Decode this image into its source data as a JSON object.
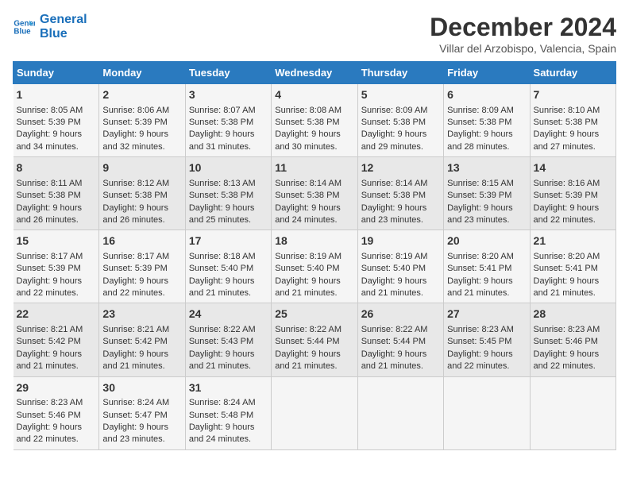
{
  "logo": {
    "line1": "General",
    "line2": "Blue"
  },
  "title": "December 2024",
  "subtitle": "Villar del Arzobispo, Valencia, Spain",
  "days_of_week": [
    "Sunday",
    "Monday",
    "Tuesday",
    "Wednesday",
    "Thursday",
    "Friday",
    "Saturday"
  ],
  "weeks": [
    [
      {
        "day": 1,
        "sunrise": "8:05 AM",
        "sunset": "5:39 PM",
        "daylight": "9 hours and 34 minutes."
      },
      {
        "day": 2,
        "sunrise": "8:06 AM",
        "sunset": "5:39 PM",
        "daylight": "9 hours and 32 minutes."
      },
      {
        "day": 3,
        "sunrise": "8:07 AM",
        "sunset": "5:38 PM",
        "daylight": "9 hours and 31 minutes."
      },
      {
        "day": 4,
        "sunrise": "8:08 AM",
        "sunset": "5:38 PM",
        "daylight": "9 hours and 30 minutes."
      },
      {
        "day": 5,
        "sunrise": "8:09 AM",
        "sunset": "5:38 PM",
        "daylight": "9 hours and 29 minutes."
      },
      {
        "day": 6,
        "sunrise": "8:09 AM",
        "sunset": "5:38 PM",
        "daylight": "9 hours and 28 minutes."
      },
      {
        "day": 7,
        "sunrise": "8:10 AM",
        "sunset": "5:38 PM",
        "daylight": "9 hours and 27 minutes."
      }
    ],
    [
      {
        "day": 8,
        "sunrise": "8:11 AM",
        "sunset": "5:38 PM",
        "daylight": "9 hours and 26 minutes."
      },
      {
        "day": 9,
        "sunrise": "8:12 AM",
        "sunset": "5:38 PM",
        "daylight": "9 hours and 26 minutes."
      },
      {
        "day": 10,
        "sunrise": "8:13 AM",
        "sunset": "5:38 PM",
        "daylight": "9 hours and 25 minutes."
      },
      {
        "day": 11,
        "sunrise": "8:14 AM",
        "sunset": "5:38 PM",
        "daylight": "9 hours and 24 minutes."
      },
      {
        "day": 12,
        "sunrise": "8:14 AM",
        "sunset": "5:38 PM",
        "daylight": "9 hours and 23 minutes."
      },
      {
        "day": 13,
        "sunrise": "8:15 AM",
        "sunset": "5:39 PM",
        "daylight": "9 hours and 23 minutes."
      },
      {
        "day": 14,
        "sunrise": "8:16 AM",
        "sunset": "5:39 PM",
        "daylight": "9 hours and 22 minutes."
      }
    ],
    [
      {
        "day": 15,
        "sunrise": "8:17 AM",
        "sunset": "5:39 PM",
        "daylight": "9 hours and 22 minutes."
      },
      {
        "day": 16,
        "sunrise": "8:17 AM",
        "sunset": "5:39 PM",
        "daylight": "9 hours and 22 minutes."
      },
      {
        "day": 17,
        "sunrise": "8:18 AM",
        "sunset": "5:40 PM",
        "daylight": "9 hours and 21 minutes."
      },
      {
        "day": 18,
        "sunrise": "8:19 AM",
        "sunset": "5:40 PM",
        "daylight": "9 hours and 21 minutes."
      },
      {
        "day": 19,
        "sunrise": "8:19 AM",
        "sunset": "5:40 PM",
        "daylight": "9 hours and 21 minutes."
      },
      {
        "day": 20,
        "sunrise": "8:20 AM",
        "sunset": "5:41 PM",
        "daylight": "9 hours and 21 minutes."
      },
      {
        "day": 21,
        "sunrise": "8:20 AM",
        "sunset": "5:41 PM",
        "daylight": "9 hours and 21 minutes."
      }
    ],
    [
      {
        "day": 22,
        "sunrise": "8:21 AM",
        "sunset": "5:42 PM",
        "daylight": "9 hours and 21 minutes."
      },
      {
        "day": 23,
        "sunrise": "8:21 AM",
        "sunset": "5:42 PM",
        "daylight": "9 hours and 21 minutes."
      },
      {
        "day": 24,
        "sunrise": "8:22 AM",
        "sunset": "5:43 PM",
        "daylight": "9 hours and 21 minutes."
      },
      {
        "day": 25,
        "sunrise": "8:22 AM",
        "sunset": "5:44 PM",
        "daylight": "9 hours and 21 minutes."
      },
      {
        "day": 26,
        "sunrise": "8:22 AM",
        "sunset": "5:44 PM",
        "daylight": "9 hours and 21 minutes."
      },
      {
        "day": 27,
        "sunrise": "8:23 AM",
        "sunset": "5:45 PM",
        "daylight": "9 hours and 22 minutes."
      },
      {
        "day": 28,
        "sunrise": "8:23 AM",
        "sunset": "5:46 PM",
        "daylight": "9 hours and 22 minutes."
      }
    ],
    [
      {
        "day": 29,
        "sunrise": "8:23 AM",
        "sunset": "5:46 PM",
        "daylight": "9 hours and 22 minutes."
      },
      {
        "day": 30,
        "sunrise": "8:24 AM",
        "sunset": "5:47 PM",
        "daylight": "9 hours and 23 minutes."
      },
      {
        "day": 31,
        "sunrise": "8:24 AM",
        "sunset": "5:48 PM",
        "daylight": "9 hours and 24 minutes."
      },
      null,
      null,
      null,
      null
    ]
  ]
}
